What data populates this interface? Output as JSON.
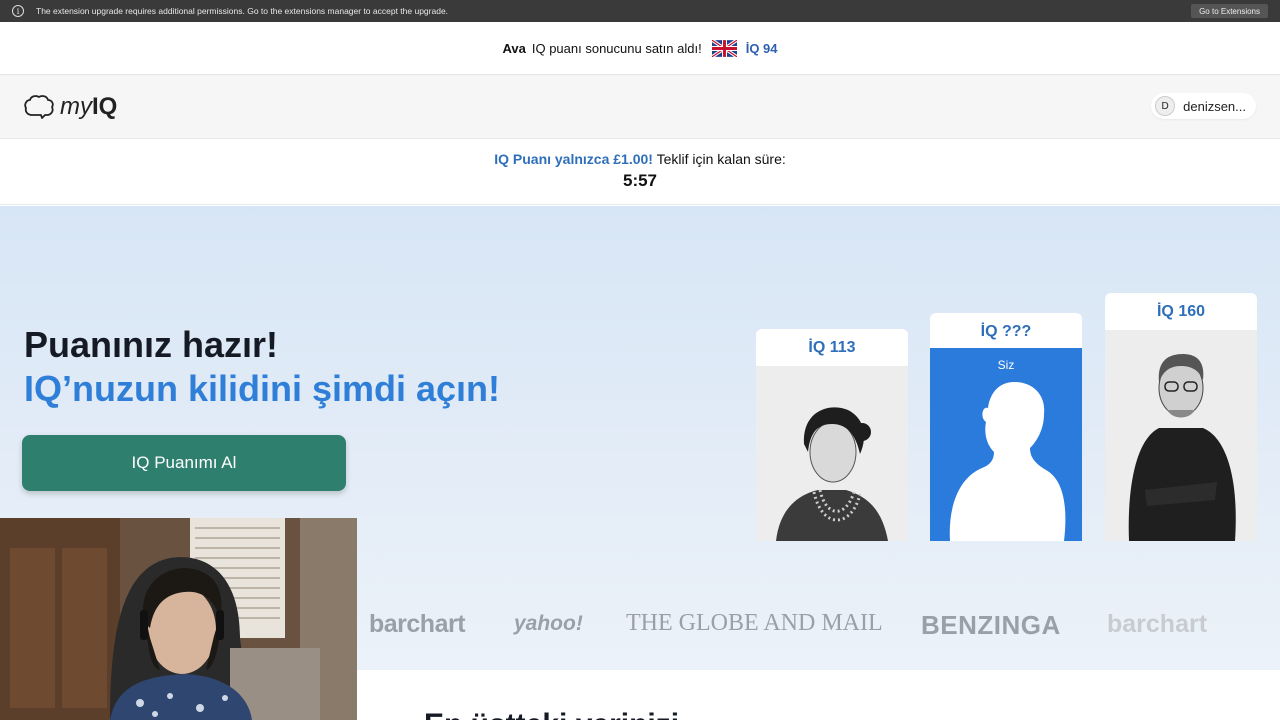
{
  "extension_bar": {
    "message": "The extension upgrade requires additional permissions. Go to the extensions manager to accept the upgrade.",
    "button": "Go to Extensions"
  },
  "notice": {
    "name": "Ava",
    "text": "IQ puanı sonucunu satın aldı!",
    "iq": "İQ 94"
  },
  "header": {
    "logo_my": "my",
    "logo_iq": "IQ",
    "user_initial": "D",
    "user_name": "denizsen..."
  },
  "offer": {
    "highlight": "IQ Puanı yalnızca £1.00!",
    "text": "Teklif için kalan süre:",
    "timer": "5:57"
  },
  "hero": {
    "title": "Puanınız hazır!",
    "subtitle": "IQ’nuzun kilidini şimdi açın!",
    "cta": "IQ Puanımı Al",
    "cards": [
      {
        "label": "İQ 113"
      },
      {
        "label": "İQ ???",
        "caption": "Siz"
      },
      {
        "label": "İQ 160"
      }
    ],
    "press": [
      "barchart",
      "yahoo!",
      "THE GLOBE AND MAIL",
      "BENZINGA",
      "barchart"
    ]
  },
  "below": {
    "heading": "En üstteki yerinizi..."
  }
}
